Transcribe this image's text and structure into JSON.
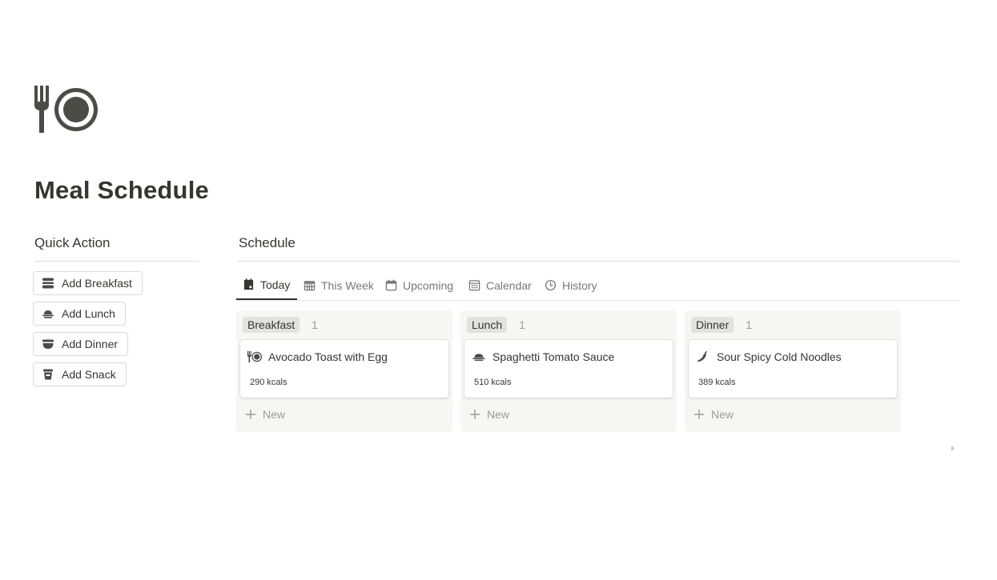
{
  "page": {
    "icon": "fork-plate-icon",
    "title": "Meal Schedule"
  },
  "quick_action": {
    "heading": "Quick Action",
    "buttons": [
      {
        "label": "Add Breakfast",
        "icon": "sandwich-icon"
      },
      {
        "label": "Add Lunch",
        "icon": "dish-icon"
      },
      {
        "label": "Add Dinner",
        "icon": "bowl-icon"
      },
      {
        "label": "Add Snack",
        "icon": "cup-icon"
      }
    ]
  },
  "schedule": {
    "heading": "Schedule",
    "tabs": [
      {
        "label": "Today",
        "icon": "calendar-day-icon",
        "active": true
      },
      {
        "label": "This Week",
        "icon": "calendar-week-icon",
        "active": false
      },
      {
        "label": "Upcoming",
        "icon": "calendar-icon",
        "active": false
      },
      {
        "label": "Calendar",
        "icon": "calendar-grid-icon",
        "active": false
      },
      {
        "label": "History",
        "icon": "clock-icon",
        "active": false
      }
    ],
    "columns": [
      {
        "tag": "Breakfast",
        "count": "1",
        "card": {
          "title": "Avocado Toast with Egg",
          "icon": "fork-plate-icon",
          "kcal": "290 kcals"
        },
        "new_label": "New"
      },
      {
        "tag": "Lunch",
        "count": "1",
        "card": {
          "title": "Spaghetti Tomato Sauce",
          "icon": "dish-icon",
          "kcal": "510 kcals"
        },
        "new_label": "New"
      },
      {
        "tag": "Dinner",
        "count": "1",
        "card": {
          "title": "Sour Spicy Cold Noodles",
          "icon": "chili-pepper-icon",
          "kcal": "389 kcals"
        },
        "new_label": "New"
      }
    ]
  },
  "colors": {
    "text": "#37352f",
    "muted": "#787774",
    "column_bg": "#f7f6f3",
    "tag_bg": "#e3e2e0",
    "icon": "#4d4b46"
  }
}
